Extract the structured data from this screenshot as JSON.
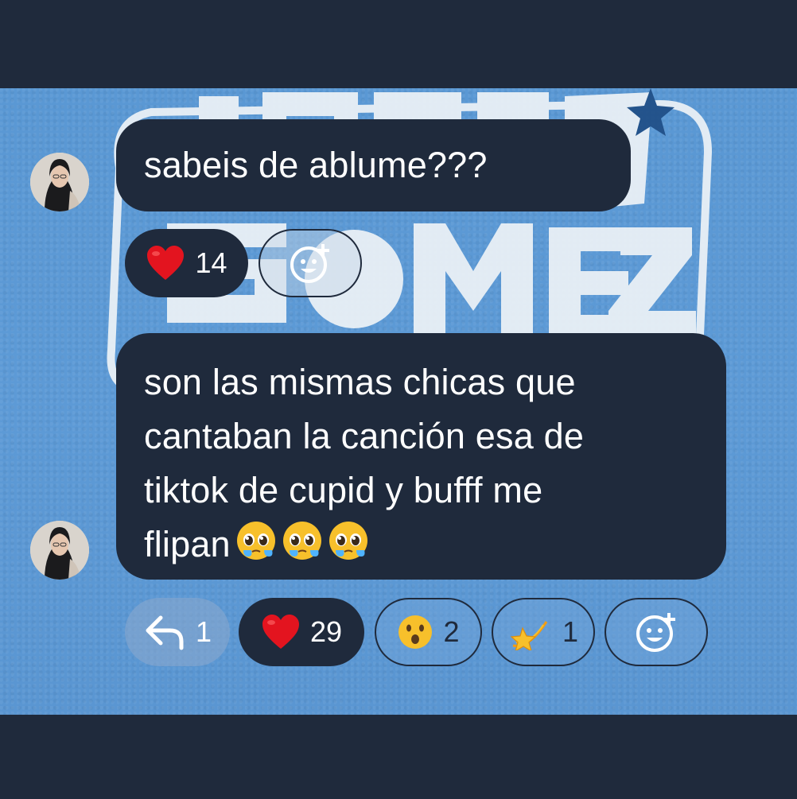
{
  "messages": [
    {
      "text_lines": [
        "sabeis de ablume???"
      ],
      "reactions": [
        {
          "icon": "heart-icon",
          "count": "14",
          "style": "dark"
        }
      ],
      "add_reaction_icon": "add-reaction-icon"
    },
    {
      "text_lines": [
        "son las mismas chicas que",
        "cantaban la canción esa de",
        "tiktok de cupid y bufff me",
        "flipan"
      ],
      "trailing_emojis": [
        "pleading-face-icon",
        "pleading-face-icon",
        "pleading-face-icon"
      ],
      "reactions": [
        {
          "icon": "reply-arrow-icon",
          "count": "1",
          "style": "ghost"
        },
        {
          "icon": "heart-icon",
          "count": "29",
          "style": "dark"
        },
        {
          "icon": "surprised-face-icon",
          "count": "2",
          "style": "outline"
        },
        {
          "icon": "dizzy-star-icon",
          "count": "1",
          "style": "outline"
        }
      ],
      "add_reaction_icon": "add-reaction-icon"
    }
  ],
  "colors": {
    "bubble": "#1f2a3c",
    "wallpaper": "#5a98d4",
    "heart": "#e3141f",
    "emoji_yellow": "#f7c02b"
  }
}
